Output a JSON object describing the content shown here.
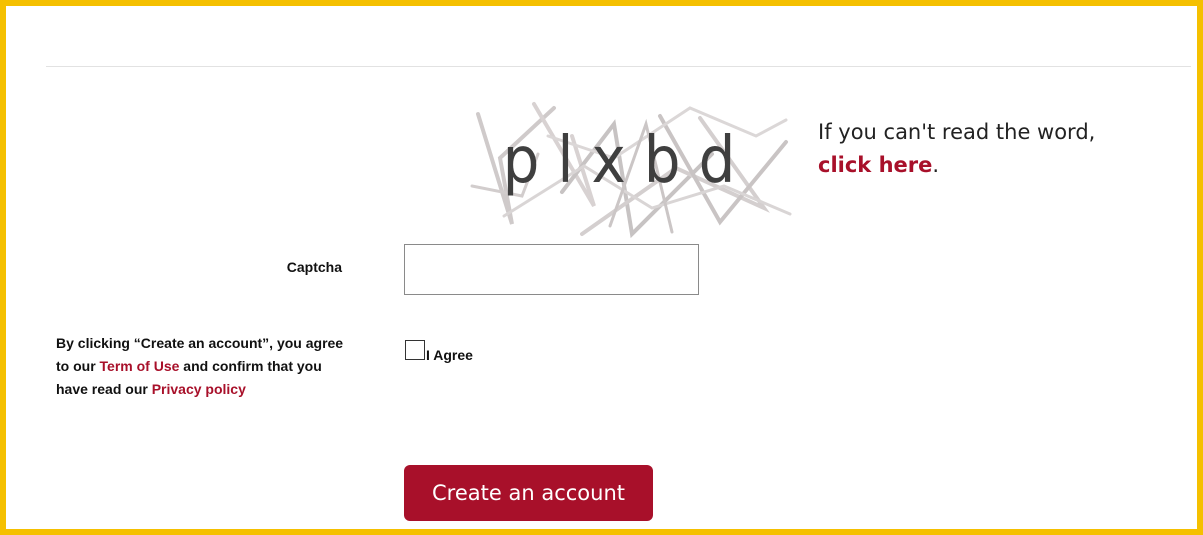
{
  "captcha": {
    "image_text": "plxbd",
    "help_text_before": "If you can't read the word, ",
    "help_link": "click here",
    "help_text_after": ".",
    "label": "Captcha",
    "input_value": ""
  },
  "terms": {
    "text_1": "By clicking “Create an account”, you agree to our ",
    "term_link": "Term of Use",
    "text_2": " and confirm that you have read our ",
    "privacy_link": "Privacy policy"
  },
  "agree": {
    "label": "I Agree",
    "checked": false
  },
  "create_button": {
    "label": "Create an account"
  },
  "colors": {
    "frame_border": "#f5c000",
    "accent": "#a8102a",
    "divider": "#e2e2e2"
  }
}
